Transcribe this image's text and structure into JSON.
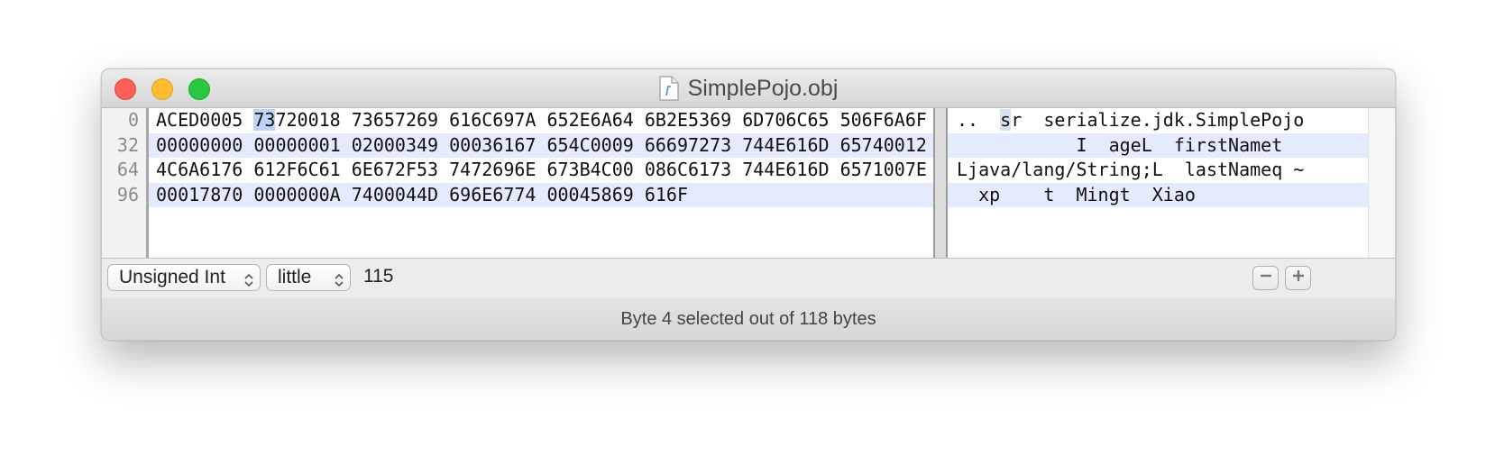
{
  "window": {
    "title": "SimplePojo.obj",
    "controls": [
      "close",
      "minimize",
      "maximize"
    ],
    "file_icon": "document-icon"
  },
  "editor": {
    "offsets": [
      "0",
      "32",
      "64",
      "96"
    ],
    "hex_rows": [
      {
        "before": "ACED0005 ",
        "selected": "73",
        "after": "720018 73657269 616C697A 652E6A64 6B2E5369 6D706C65 506F6A6F"
      },
      {
        "before": "00000000 00000001 02000349 00036167 654C0009 66697273 744E616D 65740012",
        "selected": "",
        "after": ""
      },
      {
        "before": "4C6A6176 612F6C61 6E672F53 7472696E 673B4C00 086C6173 744E616D 6571007E",
        "selected": "",
        "after": ""
      },
      {
        "before": "00017870 0000000A 7400044D 696E6774 00045869 616F",
        "selected": "",
        "after": ""
      }
    ],
    "ascii_rows": [
      {
        "before": "..  ",
        "selected": "s",
        "after": "r  serialize.jdk.SimplePojo"
      },
      {
        "before": "           I  ageL  firstNamet",
        "selected": "",
        "after": ""
      },
      {
        "before": "Ljava/lang/String;L  lastNameq ~",
        "selected": "",
        "after": ""
      },
      {
        "before": "  xp    t  Mingt  Xiao",
        "selected": "",
        "after": ""
      }
    ],
    "colors": {
      "row_highlight": "#e5ebff",
      "selection": "#bcd3f5"
    }
  },
  "controls": {
    "type_select": "Unsigned Int",
    "endian_select": "little",
    "value": "115",
    "minus_label": "minus-icon",
    "plus_label": "plus-icon"
  },
  "status": {
    "text": "Byte 4 selected out of 118 bytes"
  }
}
